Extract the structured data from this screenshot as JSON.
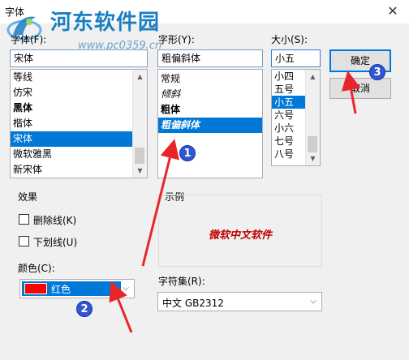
{
  "window": {
    "title": "字体",
    "close_symbol": "✕"
  },
  "watermark": {
    "title": "河东软件园",
    "url": "www.pc0359.cn"
  },
  "font": {
    "label": "字体(F):",
    "value": "宋体",
    "items": [
      "等线",
      "仿宋",
      "黑体",
      "楷体",
      "宋体",
      "微软雅黑",
      "新宋体"
    ],
    "selected_index": 4
  },
  "style": {
    "label": "字形(Y):",
    "value": "粗偏斜体",
    "items": [
      "常规",
      "倾斜",
      "粗体",
      "粗偏斜体"
    ],
    "selected_index": 3
  },
  "size": {
    "label": "大小(S):",
    "value": "小五",
    "items": [
      "小四",
      "五号",
      "小五",
      "六号",
      "小六",
      "七号",
      "八号"
    ],
    "selected_index": 2
  },
  "buttons": {
    "ok": "确定",
    "cancel": "取消"
  },
  "effects": {
    "label": "效果",
    "strikeout": "删除线(K)",
    "underline": "下划线(U)",
    "color_label": "颜色(C):",
    "color_value": "红色",
    "color_swatch": "#ff0000"
  },
  "sample": {
    "label": "示例",
    "text": "微软中文软件"
  },
  "script": {
    "label": "字符集(R):",
    "value": "中文 GB2312"
  },
  "annotations": {
    "m1": "1",
    "m2": "2",
    "m3": "3",
    "arrow_color": "#e8262a"
  }
}
